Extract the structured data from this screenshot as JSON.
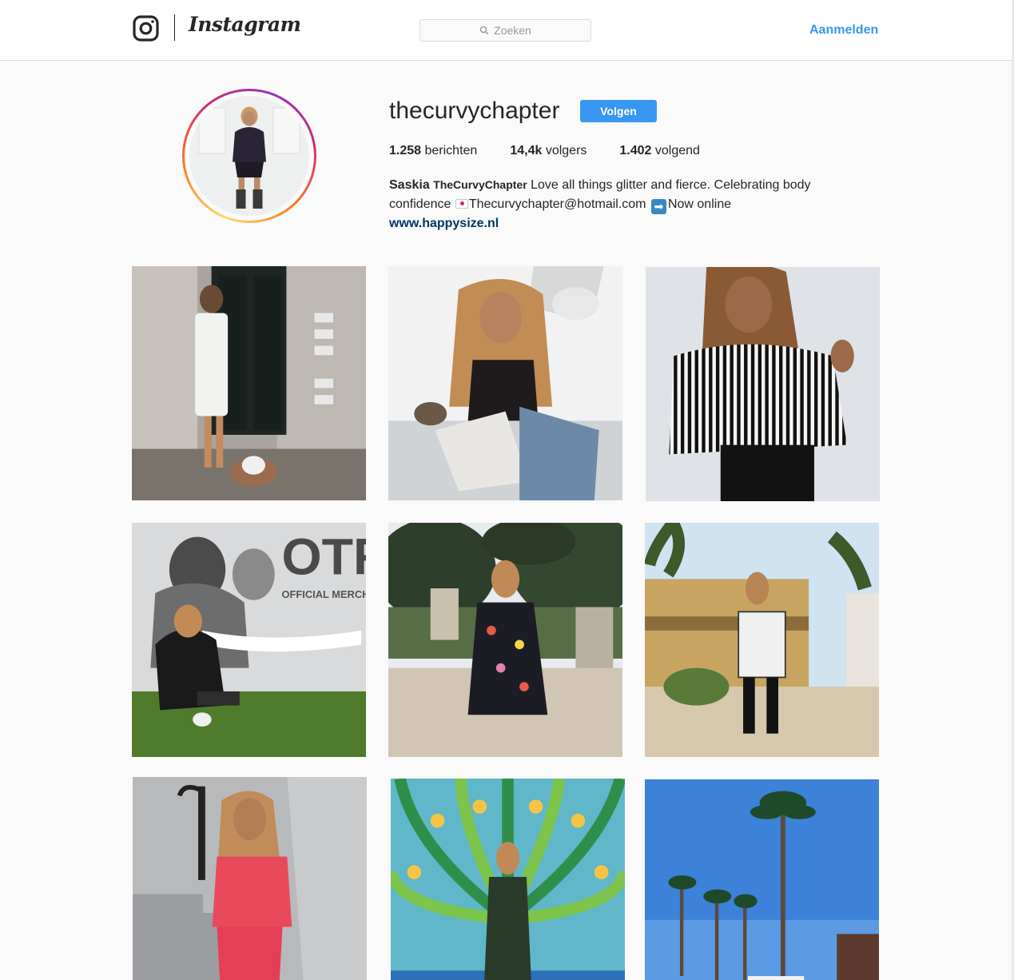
{
  "nav": {
    "wordmark": "Instagram",
    "search_placeholder": "Zoeken",
    "login_label": "Aanmelden"
  },
  "profile": {
    "username": "thecurvychapter",
    "follow_label": "Volgen",
    "stats": [
      {
        "count": "1.258",
        "label": "berichten"
      },
      {
        "count": "14,4k",
        "label": "volgers"
      },
      {
        "count": "1.402",
        "label": "volgend"
      }
    ],
    "bio": {
      "name": "Saskia",
      "brand": "TheCurvyChapter",
      "text_1": "Love all things glitter and fierce. Celebrating body confidence",
      "text_2": "Thecurvychapter@hotmail.com",
      "text_3": "Now online",
      "link": "www.happysize.nl"
    }
  },
  "posts": [
    {
      "subject": "woman in white dress with bulldog at black door"
    },
    {
      "subject": "woman in black lace top holding OTR II book"
    },
    {
      "subject": "woman in black and white striped shirt"
    },
    {
      "subject": "woman in black outfit under OTR poster",
      "visible_text": "OTR",
      "visible_subtext": "OFFICIAL MERCHA"
    },
    {
      "subject": "woman in floral dress in garden"
    },
    {
      "subject": "woman in checked dress and boots near palm trees"
    },
    {
      "subject": "woman in red suit on stairs"
    },
    {
      "subject": "woman in front of peacock mural"
    },
    {
      "subject": "palm trees and street under blue sky"
    }
  ],
  "colors": {
    "accent": "#3897f0",
    "link": "#003569",
    "text": "#262626",
    "background": "#fafafa",
    "border": "#dbdbdb"
  }
}
